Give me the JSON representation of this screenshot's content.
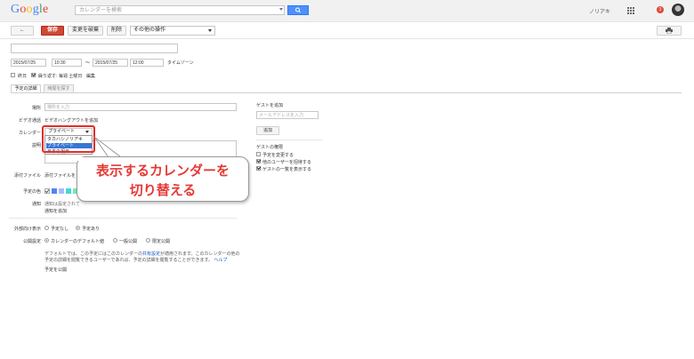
{
  "header": {
    "logo_letters": [
      "G",
      "o",
      "o",
      "g",
      "l",
      "e"
    ],
    "logo_colors": [
      "#4285f4",
      "#ea4335",
      "#fbbc05",
      "#4285f4",
      "#34a853",
      "#ea4335"
    ],
    "search_placeholder": "カレンダーを検索",
    "user_name": "ノリアキ",
    "notification_count": "3"
  },
  "toolbar": {
    "back_label": "←",
    "save_label": "保存",
    "discard_label": "変更を破棄",
    "delete_label": "削除",
    "more_actions_label": "その他の操作"
  },
  "event": {
    "title_value": "",
    "start_date": "2015/07/25",
    "start_time": "10:30",
    "range_sep": "～",
    "end_date": "2015/07/25",
    "end_time": "12:00",
    "timezone_link": "タイムゾーン",
    "allday_label": "終日",
    "repeat_label": "繰り返す:",
    "repeat_summary": "毎週 土曜日",
    "repeat_edit": "編集"
  },
  "tabs": {
    "details": "予定の詳細",
    "find_time": "時間を探す"
  },
  "details": {
    "location_label": "場所",
    "location_placeholder": "場所を入力",
    "video_label": "ビデオ通話",
    "video_link": "ビデオハングアウトを追加",
    "calendar_label": "カレンダー",
    "calendar_selected": "プライベート",
    "calendar_options": [
      "タカハシノリアキ",
      "プライベート",
      "日本の祝日"
    ],
    "description_label": "説明",
    "attachment_label": "添付ファイル",
    "attachment_link": "添付ファイルを",
    "color_label": "予定の色",
    "notification_label": "通知",
    "notification_text": "通知は設定されて",
    "notification_add": "通知を追加"
  },
  "visibility": {
    "show_me_as_label": "外部向け表示",
    "available": "予定なし",
    "busy": "予定あり",
    "privacy_label": "公開設定",
    "calendar_default": "カレンダーのデフォルト値",
    "public": "一般公開",
    "private": "限定公開",
    "note_line1": "デフォルトでは、この予定にはこのカレンダーの",
    "note_link": "共有設定",
    "note_line1b": "が適用されます。このカレンダーの他の",
    "note_line2": "予定の詳細を閲覧できるユーザーであれば、予定の詳細を閲覧することができます。",
    "help_link": "ヘルプ",
    "publish_link": "予定を公開"
  },
  "guests": {
    "add_guest_label": "ゲストを追加",
    "email_placeholder": "メールアドレスを入力",
    "add_button": "追加",
    "permissions_label": "ゲストの権限",
    "perm_modify": "予定を変更する",
    "perm_invite": "他のユーザーを招待する",
    "perm_see_list": "ゲストの一覧を表示する"
  },
  "callout": {
    "line1": "表示するカレンダーを",
    "line2": "切り替える",
    "accent_color": "#e53935"
  },
  "event_colors": [
    "#5484ed",
    "#a4bdfc",
    "#46d6db",
    "#7ae7bf",
    "#51b749"
  ]
}
